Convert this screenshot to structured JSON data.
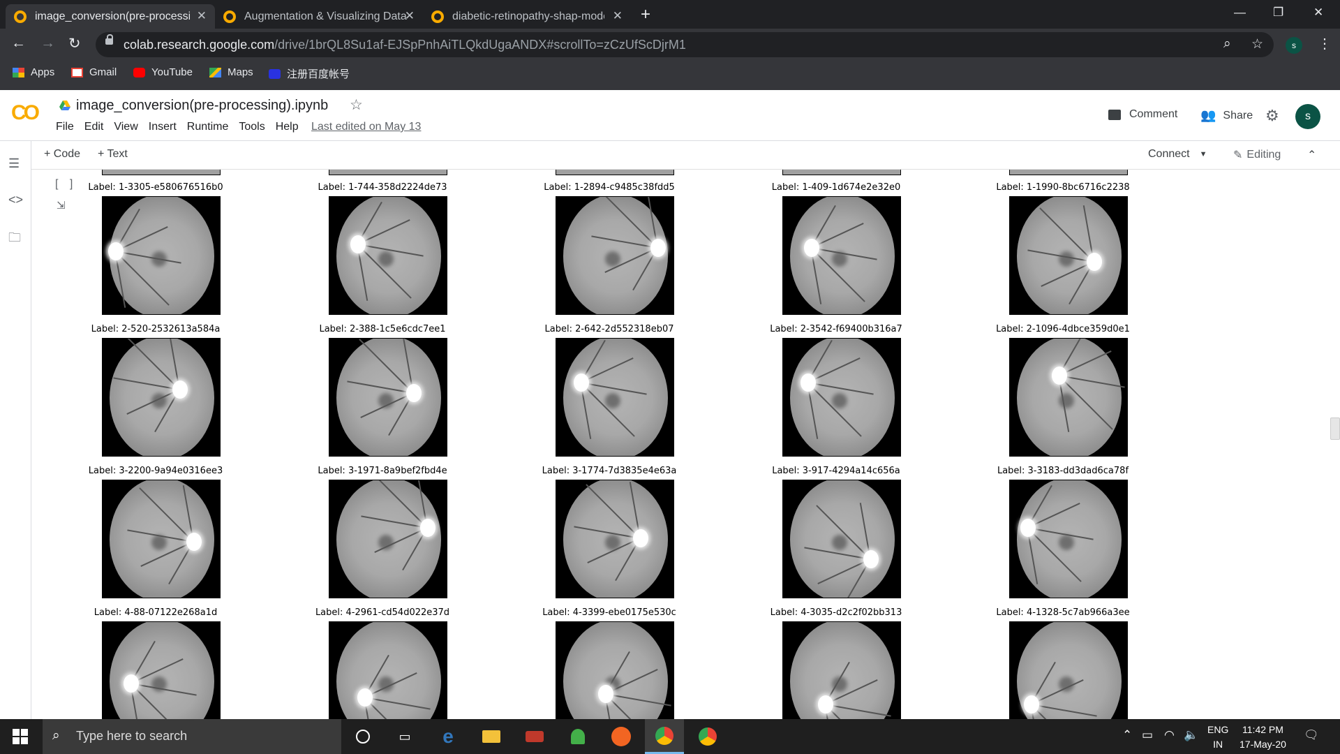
{
  "browser": {
    "tabs": [
      {
        "title": "image_conversion(pre-processing)",
        "active": true
      },
      {
        "title": "Augmentation & Visualizing Data",
        "active": false
      },
      {
        "title": "diabetic-retinopathy-shap-model",
        "active": false
      }
    ],
    "new_tab_icon": "+",
    "url_host": "colab.research.google.com",
    "url_path": "/drive/1brQL8Su1af-EJSpPnhAiTLQkdUgaANDX#scrollTo=zCzUfScDjrM1",
    "profile_initial": "s",
    "bookmarks": [
      {
        "label": "Apps",
        "icon": "apps-grid-icon",
        "color": "#4285f4"
      },
      {
        "label": "Gmail",
        "icon": "gmail-icon",
        "color": "#ea4335"
      },
      {
        "label": "YouTube",
        "icon": "youtube-icon",
        "color": "#ff0000"
      },
      {
        "label": "Maps",
        "icon": "maps-icon",
        "color": "#34a853"
      },
      {
        "label": "注册百度帐号",
        "icon": "baidu-icon",
        "color": "#2932e1"
      }
    ]
  },
  "colab": {
    "logo": "CO",
    "notebook_title": "image_conversion(pre-processing).ipynb",
    "menu": [
      "File",
      "Edit",
      "View",
      "Insert",
      "Runtime",
      "Tools",
      "Help"
    ],
    "last_edited": "Last edited on May 13",
    "comment_label": "Comment",
    "share_label": "Share",
    "user_initial": "s",
    "add_code_label": "+ Code",
    "add_text_label": "+ Text",
    "connect_label": "Connect",
    "editing_label": "Editing",
    "cell_bracket": "[ ]"
  },
  "images": {
    "rows": [
      [
        "Label: 1-3305-e580676516b0",
        "Label: 1-744-358d2224de73",
        "Label: 1-2894-c9485c38fdd5",
        "Label: 1-409-1d674e2e32e0",
        "Label: 1-1990-8bc6716c2238"
      ],
      [
        "Label: 2-520-2532613a584a",
        "Label: 2-388-1c5e6cdc7ee1",
        "Label: 2-642-2d552318eb07",
        "Label: 2-3542-f69400b316a7",
        "Label: 2-1096-4dbce359d0e1"
      ],
      [
        "Label: 3-2200-9a94e0316ee3",
        "Label: 3-1971-8a9bef2fbd4e",
        "Label: 3-1774-7d3835e4e63a",
        "Label: 3-917-4294a14c656a",
        "Label: 3-3183-dd3dad6ca78f"
      ],
      [
        "Label: 4-88-07122e268a1d",
        "Label: 4-2961-cd54d022e37d",
        "Label: 4-3399-ebe0175e530c",
        "Label: 4-3035-d2c2f02bb313",
        "Label: 4-1328-5c7ab966a3ee"
      ]
    ]
  },
  "taskbar": {
    "search_placeholder": "Type here to search",
    "lang_line1": "ENG",
    "lang_line2": "IN",
    "time": "11:42 PM",
    "date": "17-May-20"
  }
}
